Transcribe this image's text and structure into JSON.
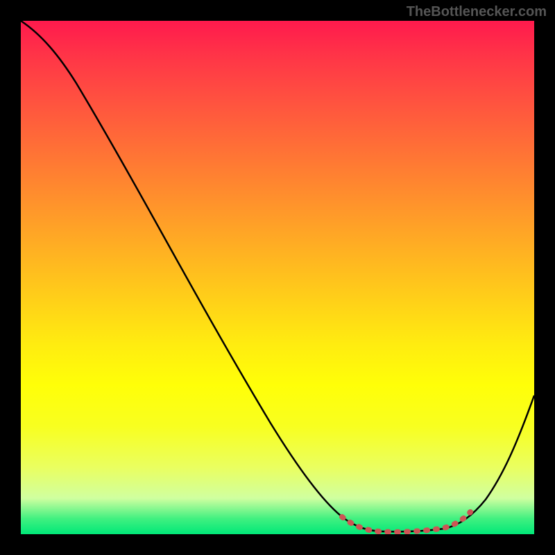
{
  "watermark": "TheBottlenecker.com",
  "chart_data": {
    "type": "line",
    "title": "",
    "xlabel": "",
    "ylabel": "",
    "xlim": [
      0,
      100
    ],
    "ylim": [
      0,
      100
    ],
    "series": [
      {
        "name": "curve",
        "x": [
          0,
          5,
          10,
          15,
          20,
          25,
          30,
          35,
          40,
          45,
          50,
          55,
          60,
          63,
          66,
          70,
          74,
          78,
          82,
          86,
          90,
          94,
          100
        ],
        "y": [
          100,
          96,
          91,
          84,
          77,
          70,
          62,
          55,
          47,
          40,
          32,
          24,
          15,
          8,
          3,
          1,
          0.5,
          0.5,
          1,
          3,
          8,
          15,
          30
        ]
      }
    ],
    "highlight_zone": {
      "x_start": 63,
      "x_end": 86,
      "color": "#d26060"
    },
    "gradient_colors": {
      "top": "#ff1a4d",
      "middle": "#ffd218",
      "bottom": "#00e878"
    }
  }
}
